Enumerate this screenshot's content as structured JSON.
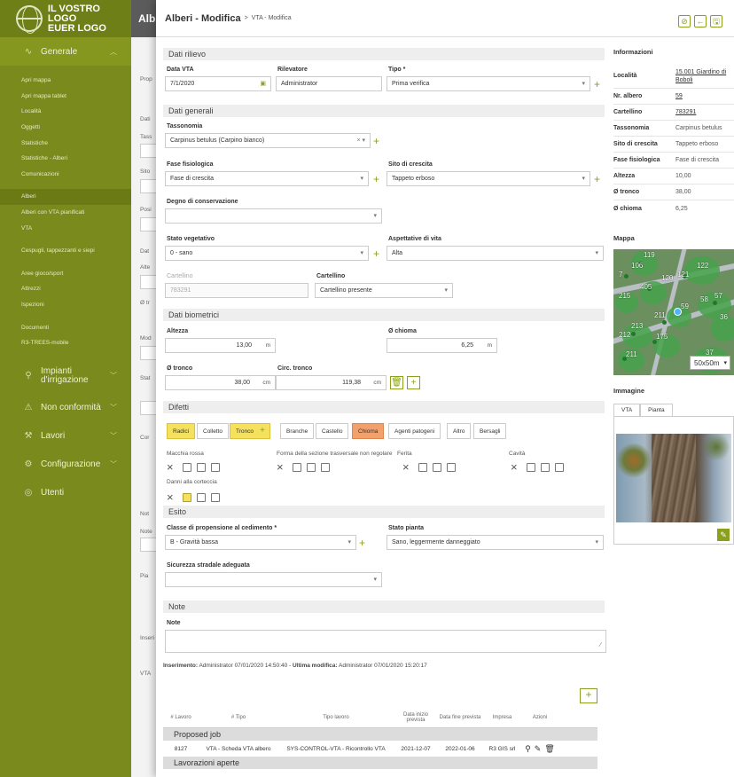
{
  "sidebar": {
    "logo_line1": "IL VOSTRO LOGO",
    "logo_line2": "EUER LOGO",
    "sections": {
      "generale": "Generale",
      "impianti": "Impianti d'irrigazione",
      "nonconf": "Non conformità",
      "lavori": "Lavori",
      "config": "Configurazione",
      "utenti": "Utenti"
    },
    "items": [
      "Apri mappa",
      "Apri mappa tablet",
      "Località",
      "Oggetti",
      "Statistiche",
      "Statistiche - Alberi",
      "Comunicazioni",
      "Alberi",
      "Alberi con VTA pianificati",
      "VTA",
      "Cespugli, tappezzanti e siepi",
      "Aree gioco/sport",
      "Attrezzi",
      "Ispezioni",
      "Documenti",
      "R3-TREES-mobile"
    ]
  },
  "bg": {
    "title": "Alb",
    "lines": [
      "Prop",
      "Dati",
      "Tass",
      "Ca",
      "Sito",
      "Ta",
      "Posi",
      "Fi",
      "Dat",
      "Alte",
      "Ø tr",
      "Mod",
      "Sti",
      "Stat",
      "Pu",
      "Cor",
      "Not",
      "Note",
      "Pia",
      "Inseri",
      "VTA"
    ]
  },
  "header": {
    "title": "Alberi - Modifica",
    "sep": ">",
    "subtitle": "VTA - Modifica",
    "btn_confirm": "⊘",
    "btn_back": "←",
    "btn_save": "🖫"
  },
  "rilievo": {
    "title": "Dati rilievo",
    "data_label": "Data VTA",
    "data_value": "7/1/2020",
    "rilevatore_label": "Rilevatore",
    "rilevatore_value": "Administrator",
    "tipo_label": "Tipo *",
    "tipo_value": "Prima verifica"
  },
  "generali": {
    "title": "Dati generali",
    "tassonomia_label": "Tassonomia",
    "tassonomia_value": "Carpinus betulus (Carpino bianco)",
    "fase_label": "Fase fisiologica",
    "fase_value": "Fase di crescita",
    "sito_label": "Sito di crescita",
    "sito_value": "Tappeto erboso",
    "degno_label": "Degno di conservazione",
    "degno_value": "",
    "stato_label": "Stato vegetativo",
    "stato_value": "0 - sano",
    "aspett_label": "Aspettative di vita",
    "aspett_value": "Alta",
    "cart_dis_label": "Cartellino",
    "cart_dis_value": "783291",
    "cart_label": "Cartellino",
    "cart_value": "Cartellino presente"
  },
  "biometrici": {
    "title": "Dati biometrici",
    "altezza_label": "Altezza",
    "altezza_value": "13,00",
    "altezza_unit": "m",
    "chioma_label": "Ø chioma",
    "chioma_value": "6,25",
    "chioma_unit": "m",
    "tronco_label": "Ø tronco",
    "tronco_value": "38,00",
    "tronco_unit": "cm",
    "circ_label": "Circ. tronco",
    "circ_value": "119,38",
    "circ_unit": "cm"
  },
  "difetti": {
    "title": "Difetti",
    "tabs": [
      "Radici",
      "Colletto",
      "Tronco",
      "Branche",
      "Castello",
      "Chioma",
      "Agenti patogeni",
      "Altro",
      "Bersagli"
    ],
    "labels": [
      "Macchia rossa",
      "Forma della sezione trasversale non regolare",
      "Ferita",
      "Cavità",
      "Danni alla corteccia"
    ]
  },
  "esito": {
    "title": "Esito",
    "classe_label": "Classe di propensione al cedimento *",
    "classe_value": "B - Gravità bassa",
    "stato_label": "Stato pianta",
    "stato_value": "Sano, leggermente danneggiato",
    "sicurezza_label": "Sicurezza stradale adeguata",
    "sicurezza_value": ""
  },
  "note": {
    "title": "Note",
    "label": "Note",
    "value": ""
  },
  "meta": {
    "ins_label": "Inserimento:",
    "ins_value": "Administrator 07/01/2020 14:50:40 -",
    "mod_label": "Ultima modifica:",
    "mod_value": "Administrator 07/01/2020 15:20:17"
  },
  "table": {
    "add": "+",
    "headers": [
      "# Lavoro",
      "# Tipo",
      "Tipo lavoro",
      "Data inizio prevista",
      "Data fine prevista",
      "Impresa",
      "Azioni"
    ],
    "group1": "Proposed job",
    "row": [
      "8127",
      "VTA - Scheda VTA albero",
      "SYS-CONTROL-VTA - Ricontrollo VTA",
      "2021-12-07",
      "2022-01-06",
      "R3 GIS srl"
    ],
    "group2": "Lavorazioni aperte"
  },
  "info": {
    "title": "Informazioni",
    "rows": [
      {
        "k": "Località",
        "v": "15.001 Giardino di Boboli"
      },
      {
        "k": "Nr. albero",
        "v": "59"
      },
      {
        "k": "Cartellino",
        "v": "783291"
      },
      {
        "k": "Tassonomia",
        "v": "Carpinus betulus"
      },
      {
        "k": "Sito di crescita",
        "v": "Tappeto erboso"
      },
      {
        "k": "Fase fisiologica",
        "v": "Fase di crescita"
      },
      {
        "k": "Altezza",
        "v": "10,00"
      },
      {
        "k": "Ø tronco",
        "v": "38,00"
      },
      {
        "k": "Ø chioma",
        "v": "6,25"
      }
    ],
    "map_title": "Mappa",
    "map_labels": [
      "119",
      "106",
      "122",
      "7",
      "120",
      "121",
      "405",
      "215",
      "59",
      "58",
      "57",
      "211",
      "36",
      "213",
      "212",
      "175",
      "211",
      "37"
    ],
    "map_scale": "50x50m",
    "img_title": "Immagine",
    "img_tabs": [
      "VTA",
      "Pianta"
    ]
  }
}
